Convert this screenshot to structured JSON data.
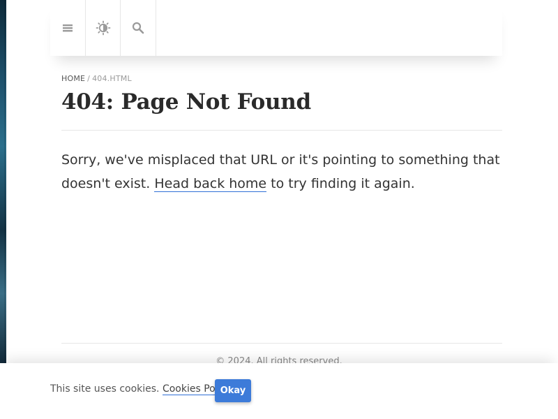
{
  "topbar": {
    "menu_icon": "hamburger-menu-icon",
    "theme_icon": "brightness-toggle-icon",
    "search_icon": "search-icon"
  },
  "breadcrumb": {
    "home": "HOME",
    "separator": "/",
    "current": "404.HTML"
  },
  "page": {
    "title": "404: Page Not Found",
    "body_before_link": "Sorry, we've misplaced that URL or it's pointing to something that doesn't exist. ",
    "link_text": "Head back home",
    "body_after_link": " to try finding it again."
  },
  "footer": {
    "text": "© 2024. All rights reserved."
  },
  "cookie_banner": {
    "text_before": "This site uses cookies. ",
    "policy_link": "Cookies Policy",
    "text_after": ".",
    "button_label": "Okay",
    "button_color": "#3d7bd9"
  },
  "colors": {
    "accent": "#3d7bd9",
    "link_underline": "#2f6fd6"
  }
}
